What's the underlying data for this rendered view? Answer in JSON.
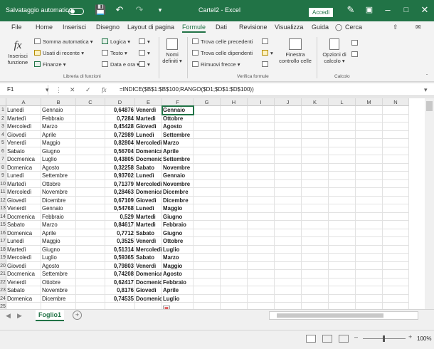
{
  "titlebar": {
    "autosave": "Salvataggio automatico",
    "doc_title": "Cartel2  -  Excel",
    "signin": "Accedi"
  },
  "tabs": [
    "File",
    "Home",
    "Inserisci",
    "Disegno",
    "Layout di pagina",
    "Formule",
    "Dati",
    "Revisione",
    "Visualizza",
    "Guida"
  ],
  "active_tab": "Formule",
  "search": "Cerca",
  "ribbon": {
    "insert_function": "Inserisci funzione",
    "autosum": "Somma automatica",
    "recent": "Usati di recente",
    "finance": "Finanze",
    "logic": "Logica",
    "text": "Testo",
    "datetime": "Data e ora",
    "library_label": "Libreria di funzioni",
    "defined_names": "Nomi definiti",
    "trace_precedents": "Trova celle precedenti",
    "trace_dependents": "Trova celle dipendenti",
    "remove_arrows": "Rimuovi frecce",
    "watch_window": "Finestra controllo celle",
    "audit_label": "Verifica formule",
    "calc_options": "Opzioni di calcolo",
    "calc_label": "Calcolo"
  },
  "namebox": "F1",
  "formula": "=INDICE($B$1:$B$100;RANGO($D1;$D$1:$D$100))",
  "columns": [
    "A",
    "B",
    "C",
    "D",
    "E",
    "F",
    "G",
    "H",
    "I",
    "J",
    "K",
    "L",
    "M",
    "N"
  ],
  "rows": [
    [
      "Lunedì",
      "Gennaio",
      "",
      "0,64876",
      "Venerdì",
      "Gennaio"
    ],
    [
      "Martedì",
      "Febbraio",
      "",
      "0,7284",
      "Martedì",
      "Ottobre"
    ],
    [
      "Mercoledì",
      "Marzo",
      "",
      "0,45428",
      "Giovedì",
      "Agosto"
    ],
    [
      "Giovedì",
      "Aprile",
      "",
      "0,72989",
      "Lunedì",
      "Settembre"
    ],
    [
      "Venerdì",
      "Maggio",
      "",
      "0,82804",
      "Mercoledì",
      "Marzo"
    ],
    [
      "Sabato",
      "Giugno",
      "",
      "0,56704",
      "Domenica",
      "Aprile"
    ],
    [
      "Docmenica",
      "Luglio",
      "",
      "0,43805",
      "Docmenica",
      "Settembre"
    ],
    [
      "Domenica",
      "Agosto",
      "",
      "0,32258",
      "Sabato",
      "Novembre"
    ],
    [
      "Lunedì",
      "Settembre",
      "",
      "0,93702",
      "Lunedì",
      "Gennaio"
    ],
    [
      "Martedì",
      "Ottobre",
      "",
      "0,71379",
      "Mercoledì",
      "Novembre"
    ],
    [
      "Mercoledì",
      "Novembre",
      "",
      "0,28463",
      "Domenica",
      "Dicembre"
    ],
    [
      "Giovedì",
      "Dicembre",
      "",
      "0,67109",
      "Giovedì",
      "Dicembre"
    ],
    [
      "Venerdì",
      "Gennaio",
      "",
      "0,54768",
      "Lunedì",
      "Maggio"
    ],
    [
      "Docmenica",
      "Febbraio",
      "",
      "0,529",
      "Martedì",
      "Giugno"
    ],
    [
      "Sabato",
      "Marzo",
      "",
      "0,84617",
      "Martedì",
      "Febbraio"
    ],
    [
      "Domenica",
      "Aprile",
      "",
      "0,7712",
      "Sabato",
      "Giugno"
    ],
    [
      "Lunedì",
      "Maggio",
      "",
      "0,3525",
      "Venerdì",
      "Ottobre"
    ],
    [
      "Martedì",
      "Giugno",
      "",
      "0,51314",
      "Mercoledì",
      "Luglio"
    ],
    [
      "Mercoledì",
      "Luglio",
      "",
      "0,59365",
      "Sabato",
      "Marzo"
    ],
    [
      "Giovedì",
      "Agosto",
      "",
      "0,79803",
      "Venerdì",
      "Maggio"
    ],
    [
      "Docmenica",
      "Settembre",
      "",
      "0,74208",
      "Domenica",
      "Agosto"
    ],
    [
      "Venerdì",
      "Ottobre",
      "",
      "0,62417",
      "Docmenica",
      "Febbraio"
    ],
    [
      "Sabato",
      "Novembre",
      "",
      "0,8176",
      "Giovedì",
      "Aprile"
    ],
    [
      "Domenica",
      "Dicembre",
      "",
      "0,74535",
      "Docmenica",
      "Luglio"
    ]
  ],
  "sheet_tab": "Foglio1",
  "zoom": "100%",
  "colors": {
    "accent": "#217346"
  }
}
